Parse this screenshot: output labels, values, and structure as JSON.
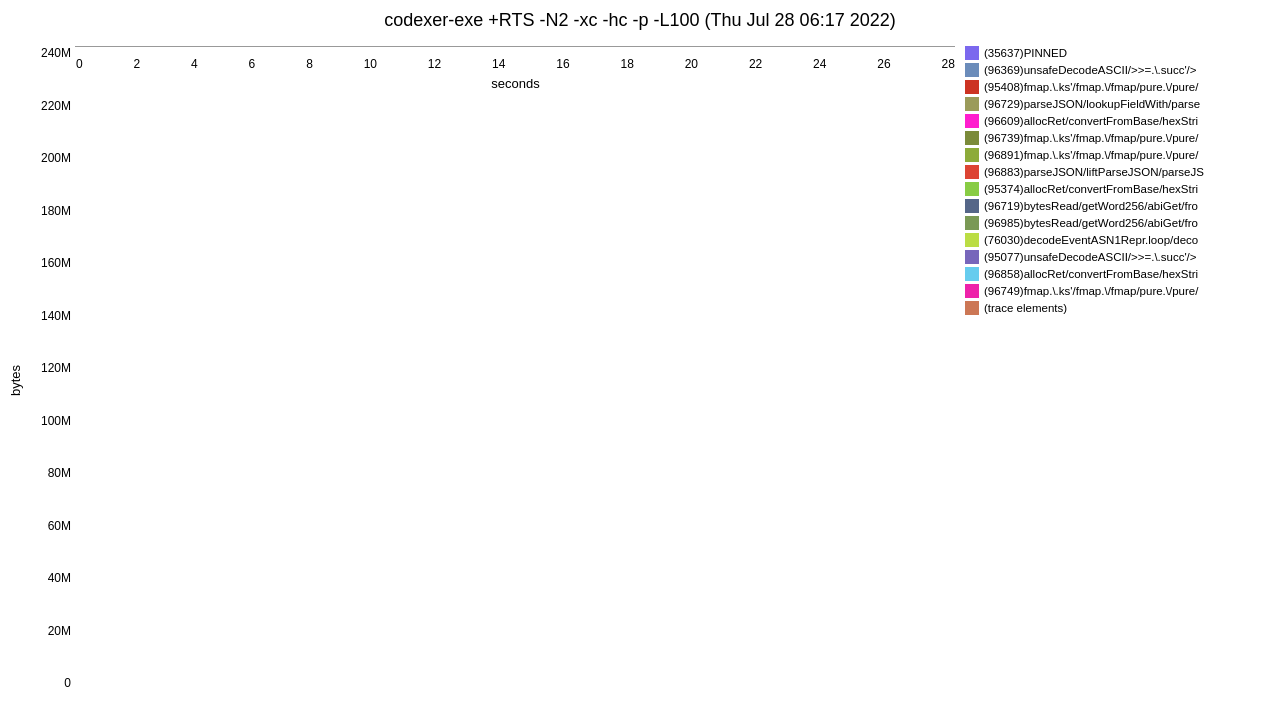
{
  "title": "codexer-exe +RTS -N2 -xc -hc -p -L100 (Thu Jul 28 06:17 2022)",
  "yAxisLabel": "bytes",
  "xAxisLabel": "seconds",
  "yTicks": [
    "240M",
    "220M",
    "200M",
    "180M",
    "160M",
    "140M",
    "120M",
    "100M",
    "80M",
    "60M",
    "40M",
    "20M",
    "0"
  ],
  "xTicks": [
    "0",
    "2",
    "4",
    "6",
    "8",
    "10",
    "12",
    "14",
    "16",
    "18",
    "20",
    "22",
    "24",
    "26",
    "28"
  ],
  "legend": [
    {
      "color": "#7b68ee",
      "label": "(35637)PINNED"
    },
    {
      "color": "#6b8cba",
      "label": "(96369)unsafeDecodeASCII/>>=.\\.succ'/>"
    },
    {
      "color": "#cc3322",
      "label": "(95408)fmap.\\.ks'/fmap.\\/fmap/pure.\\/pure/"
    },
    {
      "color": "#9b9b5a",
      "label": "(96729)parseJSON/lookupFieldWith/parse"
    },
    {
      "color": "#ff1dce",
      "label": "(96609)allocRet/convertFromBase/hexStri"
    },
    {
      "color": "#7b8b3a",
      "label": "(96739)fmap.\\.ks'/fmap.\\/fmap/pure.\\/pure/"
    },
    {
      "color": "#8dab3a",
      "label": "(96891)fmap.\\.ks'/fmap.\\/fmap/pure.\\/pure/"
    },
    {
      "color": "#dd4433",
      "label": "(96883)parseJSON/liftParseJSON/parseJS"
    },
    {
      "color": "#88cc44",
      "label": "(95374)allocRet/convertFromBase/hexStri"
    },
    {
      "color": "#556688",
      "label": "(96719)bytesRead/getWord256/abiGet/fro"
    },
    {
      "color": "#7a9955",
      "label": "(96985)bytesRead/getWord256/abiGet/fro"
    },
    {
      "color": "#bbdd44",
      "label": "(76030)decodeEventASN1Repr.loop/deco"
    },
    {
      "color": "#7766bb",
      "label": "(95077)unsafeDecodeASCII/>>=.\\.succ'/>"
    },
    {
      "color": "#66ccee",
      "label": "(96858)allocRet/convertFromBase/hexStri"
    },
    {
      "color": "#ee22aa",
      "label": "(96749)fmap.\\.ks'/fmap.\\/fmap/pure.\\/pure/"
    },
    {
      "color": "#cc7755",
      "label": "(trace elements)"
    }
  ]
}
